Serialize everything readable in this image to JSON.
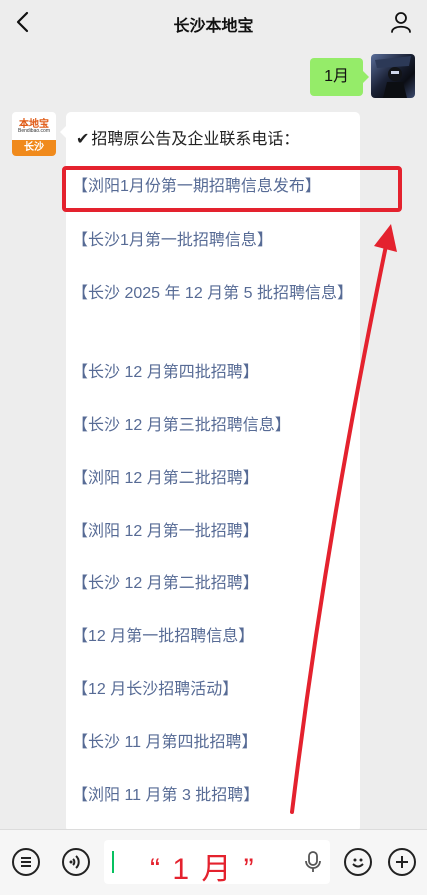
{
  "header": {
    "title": "长沙本地宝"
  },
  "chat": {
    "user_message": "1月",
    "bot_avatar": {
      "brand": "本地宝",
      "brand_sub": "Bendibao.com",
      "city": "长沙"
    },
    "bot_heading": "招聘原公告及企业联系电话：",
    "bot_heading_icon": "check-icon",
    "links": [
      "【浏阳1月份第一期招聘信息发布】",
      "【长沙1月第一批招聘信息】",
      "【长沙 2025 年 12 月第 5 批招聘信息】",
      "【长沙 12 月第四批招聘】",
      "【长沙 12 月第三批招聘信息】",
      "【浏阳 12 月第二批招聘】",
      "【浏阳 12 月第一批招聘】",
      "【长沙 12 月第二批招聘】",
      "【12 月第一批招聘信息】",
      "【12 月长沙招聘活动】",
      "【长沙 11 月第四批招聘】",
      "【浏阳 11 月第 3 批招聘】"
    ]
  },
  "input": {
    "value": "“ 1 月 ”"
  },
  "colors": {
    "highlight": "#e4222e",
    "link": "#576b95",
    "user_bubble": "#95ec69"
  }
}
